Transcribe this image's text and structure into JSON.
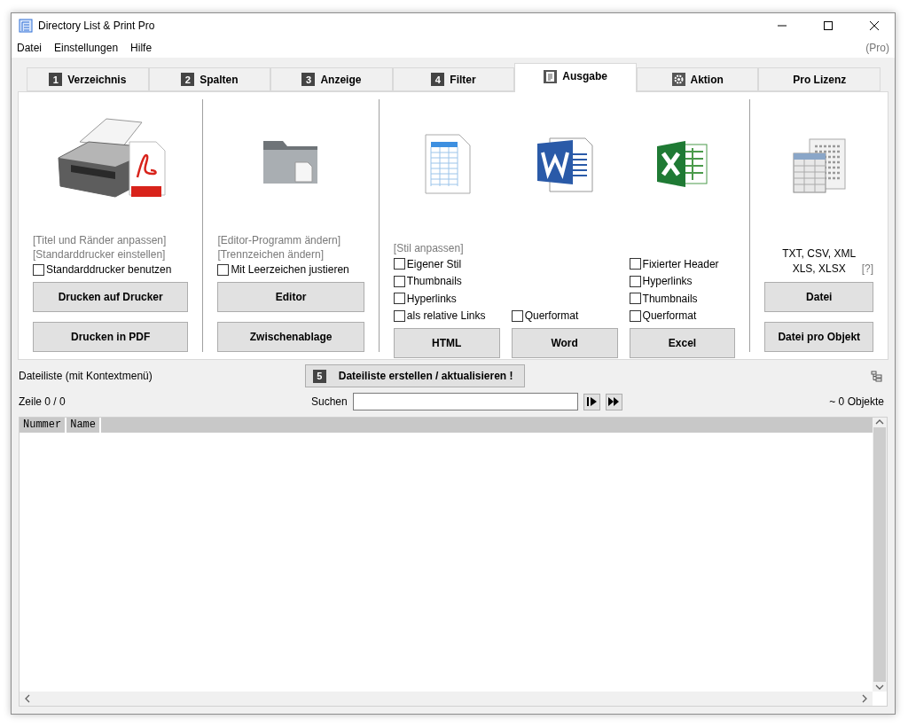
{
  "window": {
    "title": "Directory List & Print Pro"
  },
  "menu": [
    {
      "label": "Datei"
    },
    {
      "label": "Einstellungen"
    },
    {
      "label": "Hilfe"
    }
  ],
  "edition": "(Pro)",
  "tabs": [
    {
      "label": "Verzeichnis",
      "kind": "numbered",
      "badge": "1",
      "selected": false
    },
    {
      "label": "Spalten",
      "kind": "numbered",
      "badge": "2",
      "selected": false
    },
    {
      "label": "Anzeige",
      "kind": "numbered",
      "badge": "3",
      "selected": false
    },
    {
      "label": "Filter",
      "kind": "numbered",
      "badge": "4",
      "selected": false
    },
    {
      "label": "Ausgabe",
      "kind": "document",
      "selected": true
    },
    {
      "label": "Aktion",
      "kind": "settings",
      "selected": false
    },
    {
      "label": "Pro Lizenz",
      "kind": "plain",
      "selected": false
    }
  ],
  "print": {
    "links": [
      "[Titel und Ränder anpassen]",
      "[Standarddrucker einstellen]"
    ],
    "option": {
      "label": "Standarddrucker benutzen",
      "checked": false
    },
    "buttons": [
      "Drucken auf Drucker",
      "Drucken in PDF"
    ]
  },
  "editor": {
    "links": [
      "[Editor-Programm ändern]",
      "[Trennzeichen ändern]"
    ],
    "option": {
      "label": "Mit Leerzeichen justieren",
      "checked": false
    },
    "buttons": [
      "Editor",
      "Zwischenablage"
    ]
  },
  "export": {
    "link": "[Stil anpassen]",
    "columns": [
      {
        "options": [
          {
            "label": "Eigener Stil",
            "checked": false
          },
          {
            "label": "Thumbnails",
            "checked": false
          },
          {
            "label": "Hyperlinks",
            "checked": false
          },
          {
            "label": "als relative Links",
            "checked": false
          }
        ],
        "button": "HTML"
      },
      {
        "options": [
          {
            "label": "Querformat",
            "checked": false
          }
        ],
        "button": "Word"
      },
      {
        "options": [
          {
            "label": "Fixierter Header",
            "checked": false
          },
          {
            "label": "Hyperlinks",
            "checked": false
          },
          {
            "label": "Thumbnails",
            "checked": false
          },
          {
            "label": "Querformat",
            "checked": false
          }
        ],
        "button": "Excel"
      }
    ]
  },
  "file": {
    "formats": [
      "TXT, CSV, XML",
      "XLS, XLSX"
    ],
    "help": "[?]",
    "buttons": [
      "Datei",
      "Datei pro Objekt"
    ]
  },
  "list": {
    "label": "Dateiliste (mit Kontextmenü)",
    "create_button": {
      "badge": "5",
      "label": "Dateiliste erstellen / aktualisieren !"
    },
    "row_counter": "Zeile 0 / 0",
    "search_label": "Suchen",
    "count": "~ 0 Objekte",
    "columns": [
      "Nummer",
      "Name"
    ]
  }
}
